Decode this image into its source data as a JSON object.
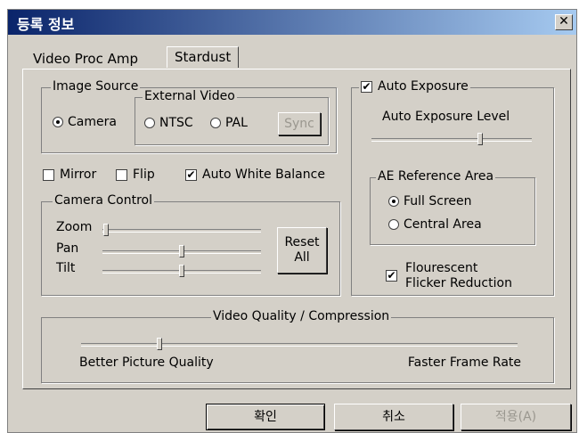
{
  "window": {
    "title": "등록 정보",
    "close_glyph": "✕"
  },
  "tabs": [
    {
      "label": "Video Proc Amp"
    },
    {
      "label": "Stardust"
    }
  ],
  "image_source": {
    "label": "Image Source",
    "camera_label": "Camera",
    "external_video_label": "External Video",
    "ntsc_label": "NTSC",
    "pal_label": "PAL",
    "sync_label": "Sync"
  },
  "options": {
    "mirror": "Mirror",
    "flip": "Flip",
    "awb": "Auto White Balance",
    "check_glyph": "✔"
  },
  "camera_control": {
    "label": "Camera Control",
    "zoom_label": "Zoom",
    "pan_label": "Pan",
    "tilt_label": "Tilt",
    "zoom_value": 0.02,
    "pan_value": 0.5,
    "tilt_value": 0.5,
    "reset_line1": "Reset",
    "reset_line2": "All"
  },
  "auto_exposure": {
    "label": "Auto Exposure",
    "level_label": "Auto Exposure Level",
    "level_value": 0.68,
    "ref_area_label": "AE Reference Area",
    "full_screen": "Full Screen",
    "central_area": "Central Area",
    "flicker_line1": "Flourescent",
    "flicker_line2": "Flicker Reduction"
  },
  "video_quality": {
    "label": "Video Quality / Compression",
    "left_label": "Better Picture Quality",
    "right_label": "Faster Frame Rate",
    "value": 0.18
  },
  "buttons": {
    "ok": "확인",
    "cancel": "취소",
    "apply": "적용(A)"
  }
}
